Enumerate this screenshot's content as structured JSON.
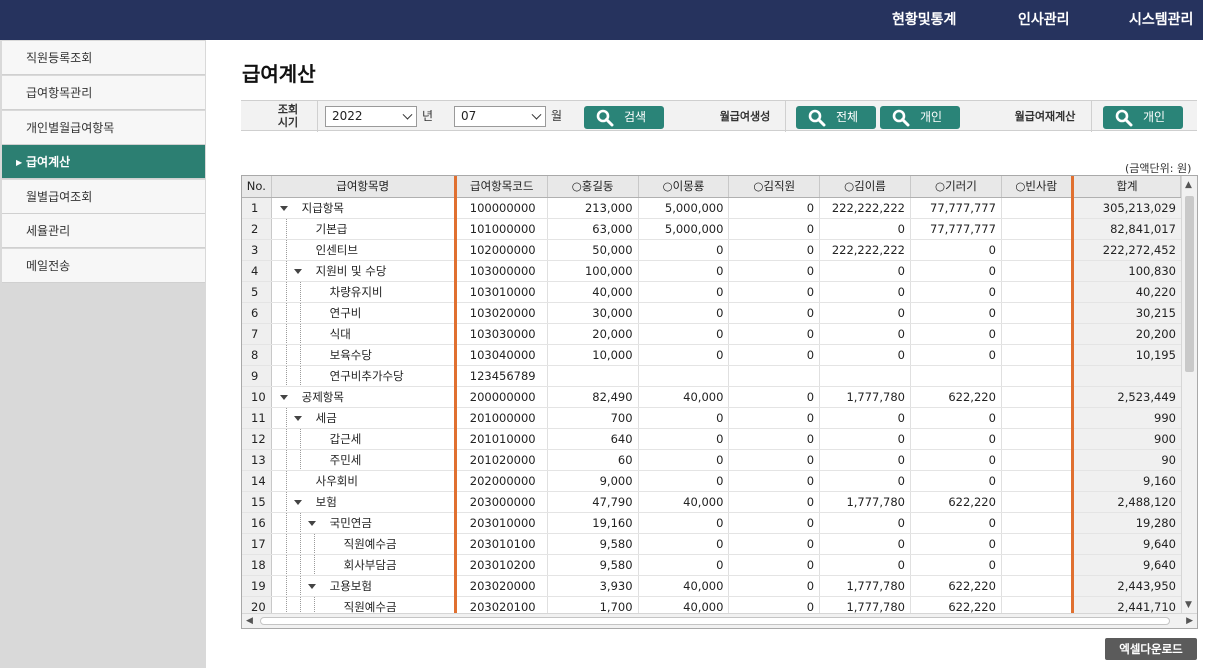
{
  "topnav": [
    "현황및통계",
    "인사관리",
    "시스템관리"
  ],
  "sidebar": {
    "items": [
      {
        "label": "직원등록조회",
        "active": false
      },
      {
        "label": "급여항목관리",
        "active": false
      },
      {
        "label": "개인별월급여항목",
        "active": false
      },
      {
        "label": "급여계산",
        "active": true
      },
      {
        "label": "월별급여조회",
        "active": false
      },
      {
        "label": "세율관리",
        "active": false
      },
      {
        "label": "메일전송",
        "active": false
      }
    ]
  },
  "page": {
    "title": "급여계산"
  },
  "search": {
    "period_label": "조회\n시기",
    "period_label_1": "조회",
    "period_label_2": "시기",
    "year_value": "2022",
    "year_unit": "년",
    "month_value": "07",
    "month_unit": "월",
    "search_button": "검색",
    "monthly_gen_label": "월급여생성",
    "all_button": "전체",
    "personal_button": "개인",
    "recalc_label": "월급여재계산",
    "recalc_personal_button": "개인"
  },
  "unit_note": "(금액단위: 원)",
  "grid": {
    "columns": [
      "No.",
      "급여항목명",
      "급여항목코드",
      "○홍길동",
      "○이몽룡",
      "○김직원",
      "○김이름",
      "○기러기",
      "○빈사람",
      "합계"
    ],
    "rows": [
      {
        "no": "1",
        "name": "지급항목",
        "depth": 0,
        "toggle": true,
        "code": "100000000",
        "v": [
          "213,000",
          "5,000,000",
          "0",
          "222,222,222",
          "77,777,777",
          ""
        ],
        "sum": "305,213,029"
      },
      {
        "no": "2",
        "name": "기본급",
        "depth": 1,
        "toggle": false,
        "code": "101000000",
        "v": [
          "63,000",
          "5,000,000",
          "0",
          "0",
          "77,777,777",
          ""
        ],
        "sum": "82,841,017"
      },
      {
        "no": "3",
        "name": "인센티브",
        "depth": 1,
        "toggle": false,
        "code": "102000000",
        "v": [
          "50,000",
          "0",
          "0",
          "222,222,222",
          "0",
          ""
        ],
        "sum": "222,272,452"
      },
      {
        "no": "4",
        "name": "지원비 및 수당",
        "depth": 1,
        "toggle": true,
        "code": "103000000",
        "v": [
          "100,000",
          "0",
          "0",
          "0",
          "0",
          ""
        ],
        "sum": "100,830"
      },
      {
        "no": "5",
        "name": "차량유지비",
        "depth": 2,
        "toggle": false,
        "code": "103010000",
        "v": [
          "40,000",
          "0",
          "0",
          "0",
          "0",
          ""
        ],
        "sum": "40,220"
      },
      {
        "no": "6",
        "name": "연구비",
        "depth": 2,
        "toggle": false,
        "code": "103020000",
        "v": [
          "30,000",
          "0",
          "0",
          "0",
          "0",
          ""
        ],
        "sum": "30,215"
      },
      {
        "no": "7",
        "name": "식대",
        "depth": 2,
        "toggle": false,
        "code": "103030000",
        "v": [
          "20,000",
          "0",
          "0",
          "0",
          "0",
          ""
        ],
        "sum": "20,200"
      },
      {
        "no": "8",
        "name": "보육수당",
        "depth": 2,
        "toggle": false,
        "code": "103040000",
        "v": [
          "10,000",
          "0",
          "0",
          "0",
          "0",
          ""
        ],
        "sum": "10,195"
      },
      {
        "no": "9",
        "name": "연구비추가수당",
        "depth": 2,
        "toggle": false,
        "code": "123456789",
        "v": [
          "",
          "",
          "",
          "",
          "",
          ""
        ],
        "sum": ""
      },
      {
        "no": "10",
        "name": "공제항목",
        "depth": 0,
        "toggle": true,
        "code": "200000000",
        "v": [
          "82,490",
          "40,000",
          "0",
          "1,777,780",
          "622,220",
          ""
        ],
        "sum": "2,523,449"
      },
      {
        "no": "11",
        "name": "세금",
        "depth": 1,
        "toggle": true,
        "code": "201000000",
        "v": [
          "700",
          "0",
          "0",
          "0",
          "0",
          ""
        ],
        "sum": "990"
      },
      {
        "no": "12",
        "name": "갑근세",
        "depth": 2,
        "toggle": false,
        "code": "201010000",
        "v": [
          "640",
          "0",
          "0",
          "0",
          "0",
          ""
        ],
        "sum": "900"
      },
      {
        "no": "13",
        "name": "주민세",
        "depth": 2,
        "toggle": false,
        "code": "201020000",
        "v": [
          "60",
          "0",
          "0",
          "0",
          "0",
          ""
        ],
        "sum": "90"
      },
      {
        "no": "14",
        "name": "사우회비",
        "depth": 1,
        "toggle": false,
        "code": "202000000",
        "v": [
          "9,000",
          "0",
          "0",
          "0",
          "0",
          ""
        ],
        "sum": "9,160"
      },
      {
        "no": "15",
        "name": "보험",
        "depth": 1,
        "toggle": true,
        "code": "203000000",
        "v": [
          "47,790",
          "40,000",
          "0",
          "1,777,780",
          "622,220",
          ""
        ],
        "sum": "2,488,120"
      },
      {
        "no": "16",
        "name": "국민연금",
        "depth": 2,
        "toggle": true,
        "code": "203010000",
        "v": [
          "19,160",
          "0",
          "0",
          "0",
          "0",
          ""
        ],
        "sum": "19,280"
      },
      {
        "no": "17",
        "name": "직원예수금",
        "depth": 3,
        "toggle": false,
        "code": "203010100",
        "v": [
          "9,580",
          "0",
          "0",
          "0",
          "0",
          ""
        ],
        "sum": "9,640"
      },
      {
        "no": "18",
        "name": "회사부담금",
        "depth": 3,
        "toggle": false,
        "code": "203010200",
        "v": [
          "9,580",
          "0",
          "0",
          "0",
          "0",
          ""
        ],
        "sum": "9,640"
      },
      {
        "no": "19",
        "name": "고용보험",
        "depth": 2,
        "toggle": true,
        "code": "203020000",
        "v": [
          "3,930",
          "40,000",
          "0",
          "1,777,780",
          "622,220",
          ""
        ],
        "sum": "2,443,950"
      },
      {
        "no": "20",
        "name": "직원예수금",
        "depth": 3,
        "toggle": false,
        "code": "203020100",
        "v": [
          "1,700",
          "40,000",
          "0",
          "1,777,780",
          "622,220",
          ""
        ],
        "sum": "2,441,710"
      }
    ]
  },
  "excel_button": "엑셀다운로드",
  "colors": {
    "topbar": "#26335e",
    "accent": "#2a8478",
    "active_menu": "#2c7f72",
    "frozen_line": "#e07030"
  },
  "icons": {
    "button_icon": "magnifier-icon",
    "tree_toggle": "caret-down-icon",
    "sidebar_active": "caret-right-icon"
  }
}
